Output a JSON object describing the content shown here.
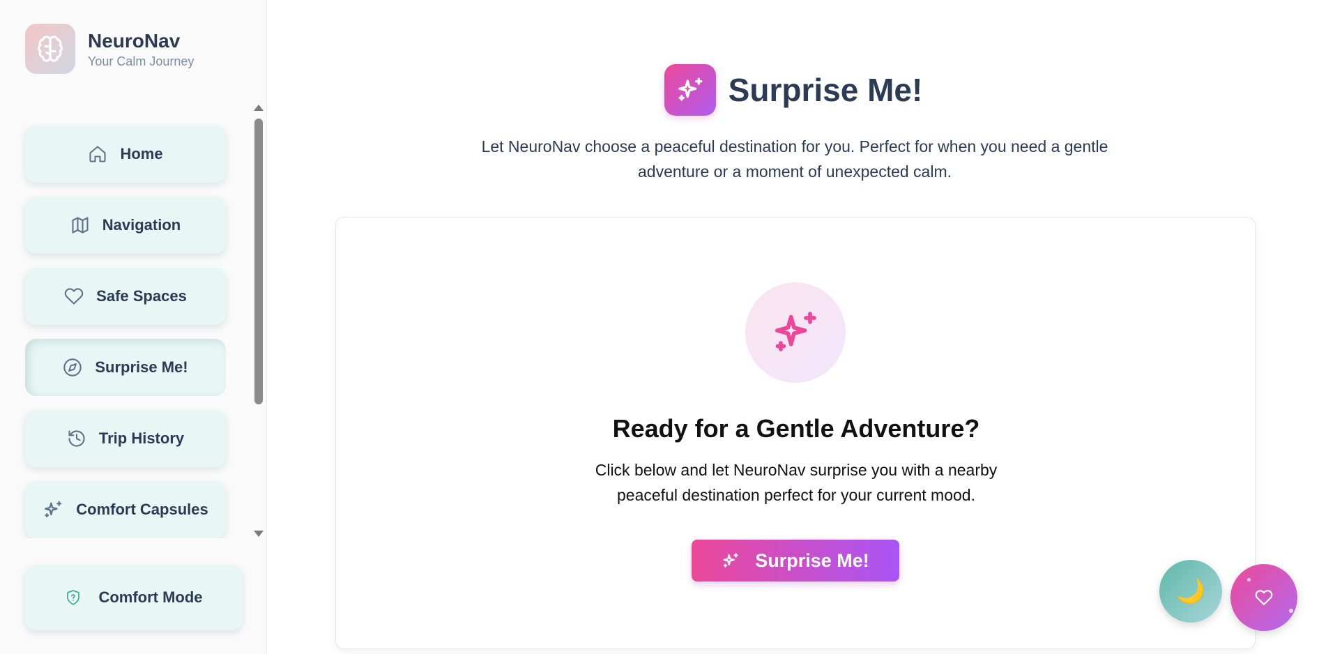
{
  "sidebar": {
    "brand": {
      "name": "NeuroNav",
      "tagline": "Your Calm Journey",
      "logo_icon": "brain-icon"
    },
    "items": [
      {
        "label": "Home",
        "icon": "home-icon",
        "active": false
      },
      {
        "label": "Navigation",
        "icon": "map-icon",
        "active": false
      },
      {
        "label": "Safe Spaces",
        "icon": "heart-icon",
        "active": false
      },
      {
        "label": "Surprise Me!",
        "icon": "compass-icon",
        "active": true
      },
      {
        "label": "Trip History",
        "icon": "history-icon",
        "active": false
      },
      {
        "label": "Comfort Capsules",
        "icon": "sparkles-icon",
        "active": false
      }
    ],
    "comfort_mode": {
      "label": "Comfort Mode",
      "icon": "shield-icon"
    }
  },
  "main": {
    "title": "Surprise Me!",
    "title_icon": "sparkles-icon",
    "description": "Let NeuroNav choose a peaceful destination for you. Perfect for when you need a gentle adventure or a moment of unexpected calm.",
    "card": {
      "icon": "sparkles-icon",
      "title": "Ready for a Gentle Adventure?",
      "description": "Click below and let NeuroNav surprise you with a nearby peaceful destination perfect for your current mood.",
      "button_label": "Surprise Me!"
    }
  },
  "floating": {
    "moon": {
      "icon": "moon-icon",
      "glyph": "🌙"
    },
    "heart": {
      "icon": "heart-icon"
    }
  },
  "colors": {
    "accent_pink": "#ec4899",
    "accent_purple": "#a855f7",
    "sidebar_item_bg": "#e8f7f5",
    "text_primary": "#2b3a55",
    "teal": "#5fb8a8"
  }
}
